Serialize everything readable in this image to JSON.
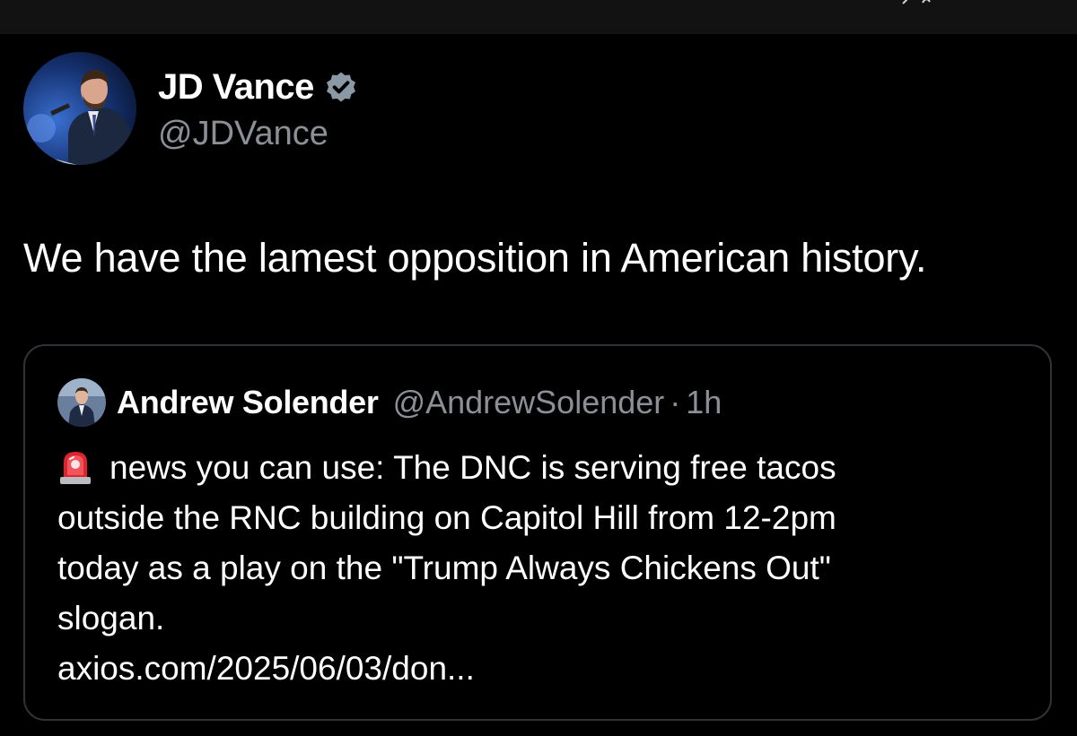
{
  "post": {
    "author_name": "JD Vance",
    "author_handle": "@JDVance",
    "verified_icon": "verified-badge-icon",
    "text": "We have the lamest opposition in American history."
  },
  "quote": {
    "author_name": "Andrew Solender",
    "author_handle": "@AndrewSolender",
    "separator": "·",
    "time": "1h",
    "icon": "police-siren-icon",
    "lines": [
      "news you can use: The DNC is serving free tacos",
      "outside the RNC building on Capitol Hill from 12-2pm",
      "today as a play on the \"Trump Always Chickens Out\"",
      "slogan.",
      "axios.com/2025/06/03/don..."
    ]
  },
  "colors": {
    "background": "#000000",
    "top_bar": "#121212",
    "text_primary": "#ffffff",
    "text_secondary": "#8b9096",
    "border": "#2f3336",
    "verified": "#8b98a5",
    "siren": "#e0242e"
  }
}
